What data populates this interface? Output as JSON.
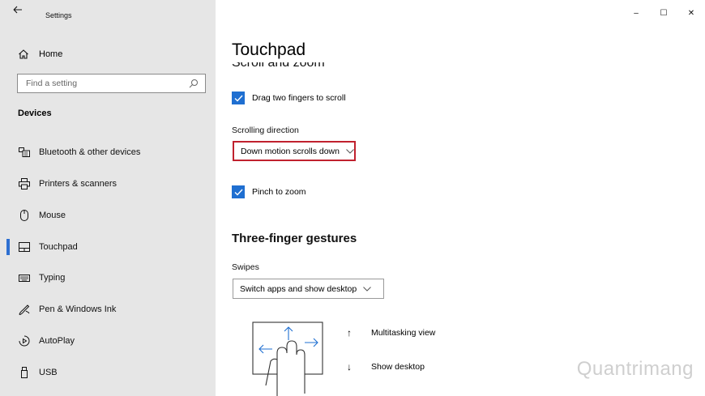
{
  "window": {
    "title": "Settings",
    "controls": {
      "minimize": "–",
      "maximize": "☐",
      "close": "✕"
    }
  },
  "sidebar": {
    "home_label": "Home",
    "search_placeholder": "Find a setting",
    "section_title": "Devices",
    "items": [
      {
        "label": "Bluetooth & other devices",
        "icon": "bluetooth-devices-icon"
      },
      {
        "label": "Printers & scanners",
        "icon": "printer-icon"
      },
      {
        "label": "Mouse",
        "icon": "mouse-icon"
      },
      {
        "label": "Touchpad",
        "icon": "touchpad-icon",
        "active": true
      },
      {
        "label": "Typing",
        "icon": "keyboard-icon"
      },
      {
        "label": "Pen & Windows Ink",
        "icon": "pen-icon"
      },
      {
        "label": "AutoPlay",
        "icon": "autoplay-icon"
      },
      {
        "label": "USB",
        "icon": "usb-icon"
      }
    ]
  },
  "main": {
    "title": "Touchpad",
    "clipped_heading": "Scroll and zoom",
    "drag_two_fingers_label": "Drag two fingers to scroll",
    "scrolling_direction_label": "Scrolling direction",
    "scrolling_direction_value": "Down motion scrolls down",
    "pinch_label": "Pinch to zoom",
    "three_finger_heading": "Three-finger gestures",
    "swipes_label": "Swipes",
    "swipes_value": "Switch apps and show desktop",
    "legend": [
      {
        "arrow": "↑",
        "label": "Multitasking view"
      },
      {
        "arrow": "↓",
        "label": "Show desktop"
      }
    ]
  },
  "watermark": "Quantrimang",
  "colors": {
    "accent": "#1f6fd1",
    "highlight": "#c0212e",
    "sidebar_bg": "#e6e6e6"
  }
}
